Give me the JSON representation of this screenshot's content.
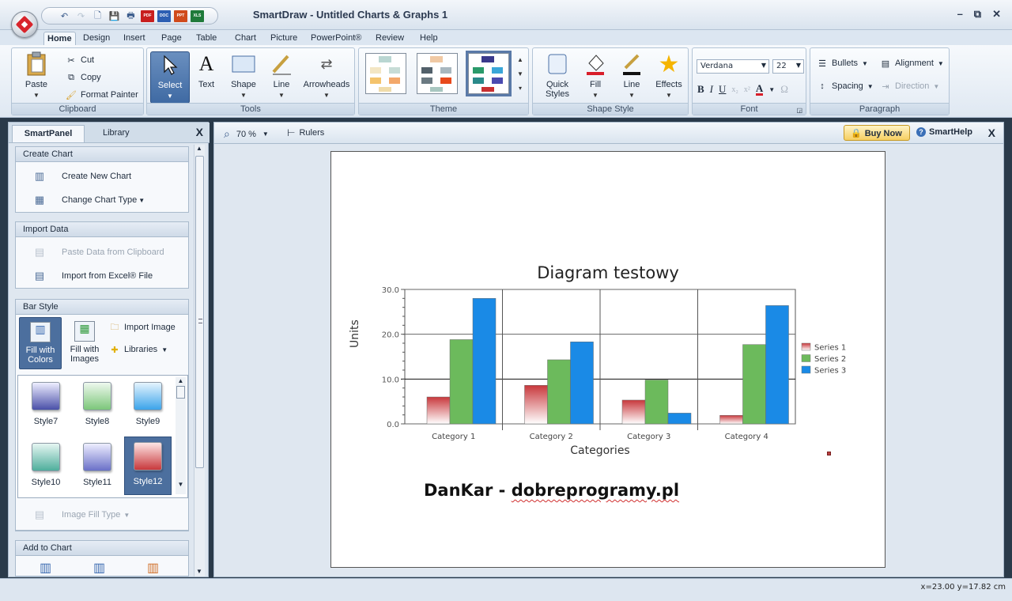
{
  "window": {
    "title": "SmartDraw - Untitled Charts & Graphs 1",
    "controls": {
      "minimize": "–",
      "restore": "⧉",
      "close": "✕"
    }
  },
  "quick_access": [
    "undo-icon",
    "redo-icon",
    "new-icon",
    "save-icon",
    "print-icon",
    "pdf-icon",
    "doc-icon",
    "ppt-icon",
    "xls-icon"
  ],
  "tabs": [
    "Home",
    "Design",
    "Insert",
    "Page",
    "Table",
    "Chart",
    "Picture",
    "PowerPoint®",
    "Review",
    "Help"
  ],
  "ribbon": {
    "clipboard": {
      "label": "Clipboard",
      "paste": "Paste",
      "cut": "Cut",
      "copy": "Copy",
      "format_painter": "Format Painter"
    },
    "tools": {
      "label": "Tools",
      "select": "Select",
      "text": "Text",
      "shape": "Shape",
      "line": "Line",
      "arrowheads": "Arrowheads"
    },
    "theme": {
      "label": "Theme"
    },
    "shape_style": {
      "label": "Shape Style",
      "quick_styles": "Quick Styles",
      "fill": "Fill",
      "line": "Line",
      "effects": "Effects"
    },
    "font": {
      "label": "Font",
      "family": "Verdana",
      "size": "22",
      "bold": "B",
      "italic": "I",
      "underline": "U",
      "font_color": "A",
      "omega": "Ω"
    },
    "paragraph": {
      "label": "Paragraph",
      "bullets": "Bullets",
      "alignment": "Alignment",
      "spacing": "Spacing",
      "direction": "Direction"
    }
  },
  "left_panel": {
    "tabs": [
      "SmartPanel",
      "Library"
    ],
    "close": "X",
    "create_chart": {
      "title": "Create Chart",
      "items": [
        "Create New Chart",
        "Change Chart Type"
      ]
    },
    "import_data": {
      "title": "Import Data",
      "items": [
        "Paste Data from Clipboard",
        "Import from Excel® File"
      ]
    },
    "bar_style": {
      "title": "Bar Style",
      "fill_colors": "Fill with Colors",
      "fill_images": "Fill with Images",
      "import_image": "Import Image",
      "libraries": "Libraries",
      "styles": [
        {
          "name": "Style7",
          "color": "#4a50a8"
        },
        {
          "name": "Style8",
          "color": "#7cc77a"
        },
        {
          "name": "Style9",
          "color": "#3ca4ea"
        },
        {
          "name": "Style10",
          "color": "#4fae9c"
        },
        {
          "name": "Style11",
          "color": "#6a70c8"
        },
        {
          "name": "Style12",
          "color": "#c8383c"
        }
      ],
      "image_fill_type": "Image Fill Type"
    },
    "add_to_chart": {
      "title": "Add to Chart"
    }
  },
  "canvas_toolbar": {
    "zoom": "70 %",
    "rulers": "Rulers",
    "buy_now": "Buy Now",
    "smart_help": "SmartHelp",
    "close": "X"
  },
  "chart_data": {
    "type": "bar",
    "title": "Diagram testowy",
    "xlabel": "Categories",
    "ylabel": "Units",
    "categories": [
      "Category 1",
      "Category 2",
      "Category 3",
      "Category 4"
    ],
    "series": [
      {
        "name": "Series 1",
        "values": [
          6.0,
          8.6,
          5.3,
          1.9
        ],
        "color": "#c8383c"
      },
      {
        "name": "Series 2",
        "values": [
          18.8,
          14.3,
          9.8,
          17.7
        ],
        "color": "#6cba5c"
      },
      {
        "name": "Series 3",
        "values": [
          28.0,
          18.3,
          2.4,
          26.4
        ],
        "color": "#1a8ae6"
      }
    ],
    "ylim": [
      0,
      30
    ],
    "yticks": [
      "0.0",
      "10.0",
      "20.0",
      "30.0"
    ],
    "grid": true,
    "legend": "right"
  },
  "page_text": {
    "watermark_prefix": "DanKar - ",
    "watermark_site": "dobreprogramy.pl"
  },
  "status": {
    "coords": "x=23.00  y=17.82 cm"
  }
}
